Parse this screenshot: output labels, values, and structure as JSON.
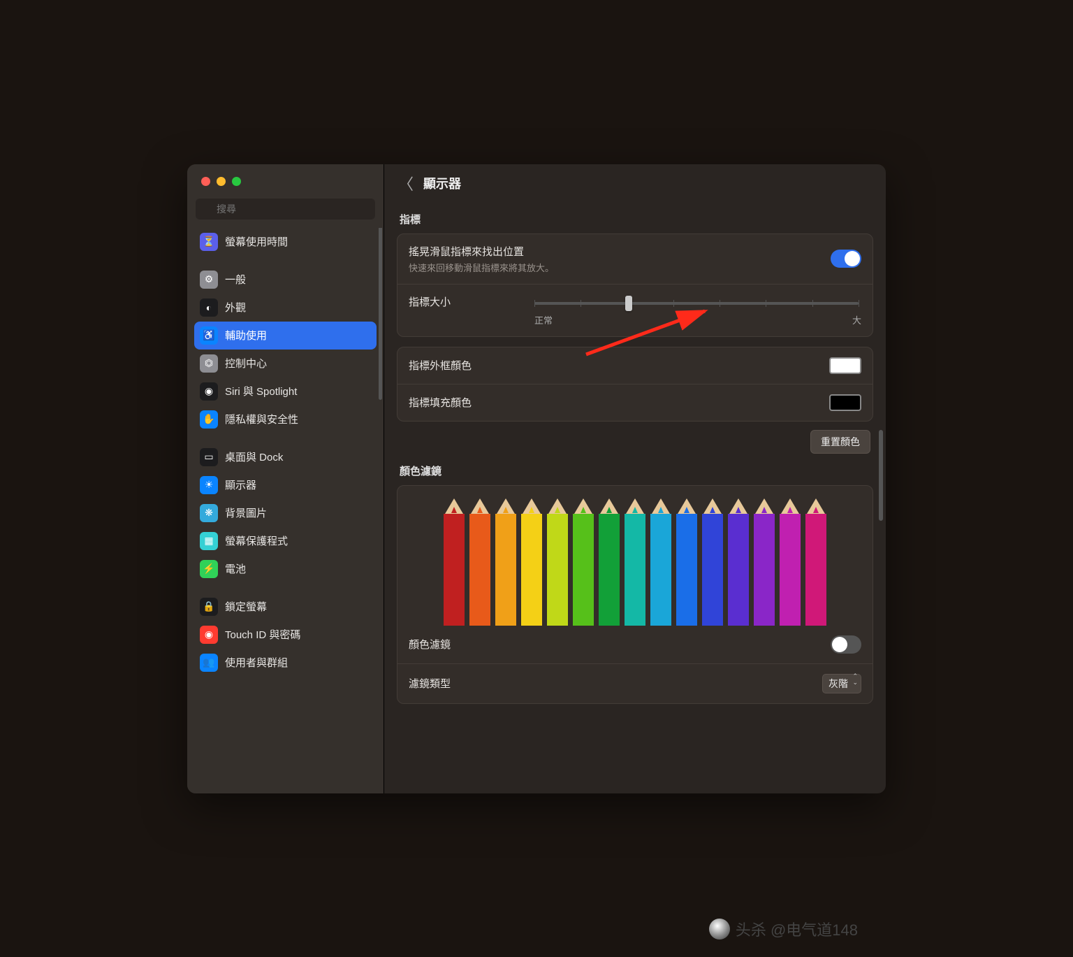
{
  "search": {
    "placeholder": "搜尋"
  },
  "sidebar": {
    "items": [
      {
        "label": "螢幕使用時間",
        "icon": "hourglass",
        "bg": "#5b5fea"
      },
      {
        "label": "一般",
        "icon": "gear",
        "bg": "#8e8e93"
      },
      {
        "label": "外觀",
        "icon": "contrast",
        "bg": "#1c1c1e"
      },
      {
        "label": "輔助使用",
        "icon": "accessibility",
        "bg": "#0a84ff",
        "selected": true
      },
      {
        "label": "控制中心",
        "icon": "switches",
        "bg": "#8e8e93"
      },
      {
        "label": "Siri 與 Spotlight",
        "icon": "siri",
        "bg": "#1c1c1e"
      },
      {
        "label": "隱私權與安全性",
        "icon": "hand",
        "bg": "#0a84ff"
      },
      {
        "label": "桌面與 Dock",
        "icon": "dock",
        "bg": "#1c1c1e"
      },
      {
        "label": "顯示器",
        "icon": "brightness",
        "bg": "#0a84ff"
      },
      {
        "label": "背景圖片",
        "icon": "flower",
        "bg": "#34aadc"
      },
      {
        "label": "螢幕保護程式",
        "icon": "screensaver",
        "bg": "#34d0d4"
      },
      {
        "label": "電池",
        "icon": "battery",
        "bg": "#30d158"
      },
      {
        "label": "鎖定螢幕",
        "icon": "lock",
        "bg": "#1c1c1e"
      },
      {
        "label": "Touch ID 與密碼",
        "icon": "fingerprint",
        "bg": "#ff3b30"
      },
      {
        "label": "使用者與群組",
        "icon": "users",
        "bg": "#0a84ff"
      }
    ]
  },
  "header": {
    "title": "顯示器"
  },
  "section_pointer": "指標",
  "shake": {
    "title": "搖晃滑鼠指標來找出位置",
    "sub": "快速來回移動滑鼠指標來將其放大。",
    "on": true
  },
  "size": {
    "label": "指標大小",
    "min": "正常",
    "max": "大"
  },
  "outline": {
    "label": "指標外框顏色",
    "color": "#ffffff"
  },
  "fill": {
    "label": "指標填充顏色",
    "color": "#000000"
  },
  "reset": "重置顏色",
  "section_filter": "顏色濾鏡",
  "filter_toggle": {
    "label": "顏色濾鏡",
    "on": false
  },
  "filter_type": {
    "label": "濾鏡類型",
    "value": "灰階"
  },
  "pencil_colors": [
    "#c02020",
    "#e85a1a",
    "#f0a018",
    "#f4d016",
    "#c0d818",
    "#56c01a",
    "#12a038",
    "#14b8a6",
    "#1aa6d8",
    "#1a6ee8",
    "#3044d8",
    "#5a2ed0",
    "#8a26c8",
    "#c020b0",
    "#d01878"
  ],
  "watermark": "头杀 @电气道148"
}
